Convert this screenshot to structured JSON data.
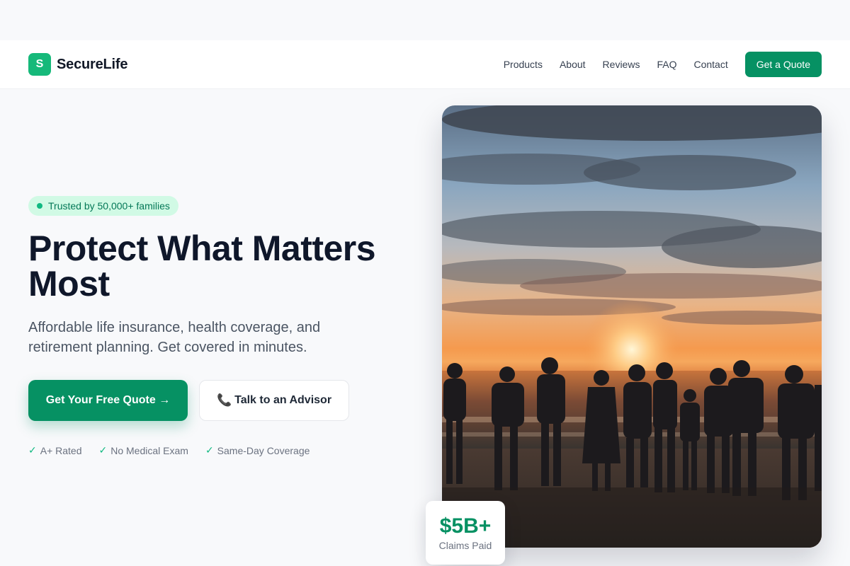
{
  "header": {
    "logo_letter": "S",
    "brand": "SecureLife",
    "nav": [
      "Products",
      "About",
      "Reviews",
      "FAQ",
      "Contact"
    ],
    "cta": "Get a Quote"
  },
  "hero": {
    "badge": "Trusted by 50,000+ families",
    "title": "Protect What Matters Most",
    "subtitle": "Affordable life insurance, health coverage, and retirement planning. Get covered in minutes.",
    "primary_cta": "Get Your Free Quote →",
    "secondary_cta": "Talk to an Advisor",
    "features": [
      "A+ Rated",
      "No Medical Exam",
      "Same-Day Coverage"
    ]
  },
  "stat": {
    "value": "$5B+",
    "label": "Claims Paid"
  },
  "colors": {
    "brand_green": "#069163",
    "accent_green": "#16b97a",
    "badge_bg": "#d1fae5"
  },
  "icons": {
    "phone": "phone-icon",
    "check": "check-icon",
    "dot": "status-dot-icon"
  }
}
